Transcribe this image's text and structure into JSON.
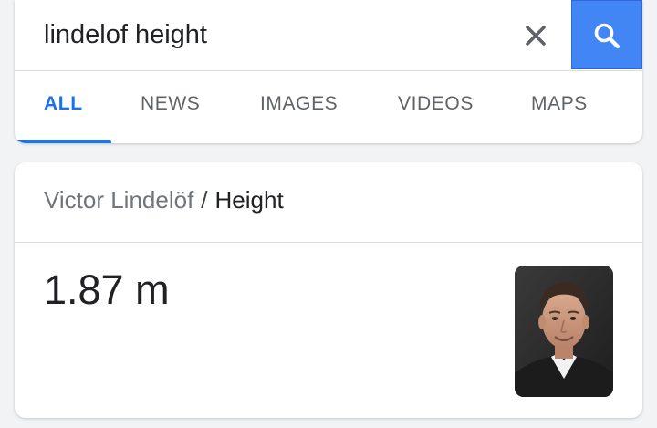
{
  "search": {
    "query": "lindelof height",
    "clear_icon": "close-icon",
    "search_icon": "search-icon",
    "accent": "#4285f4"
  },
  "tabs": [
    {
      "label": "ALL",
      "active": true
    },
    {
      "label": "NEWS",
      "active": false
    },
    {
      "label": "IMAGES",
      "active": false
    },
    {
      "label": "VIDEOS",
      "active": false
    },
    {
      "label": "MAPS",
      "active": false
    }
  ],
  "answer": {
    "entity": "Victor Lindelöf",
    "separator": "/",
    "attribute": "Height",
    "value": "1.87 m",
    "image_icon": "person-photo"
  }
}
